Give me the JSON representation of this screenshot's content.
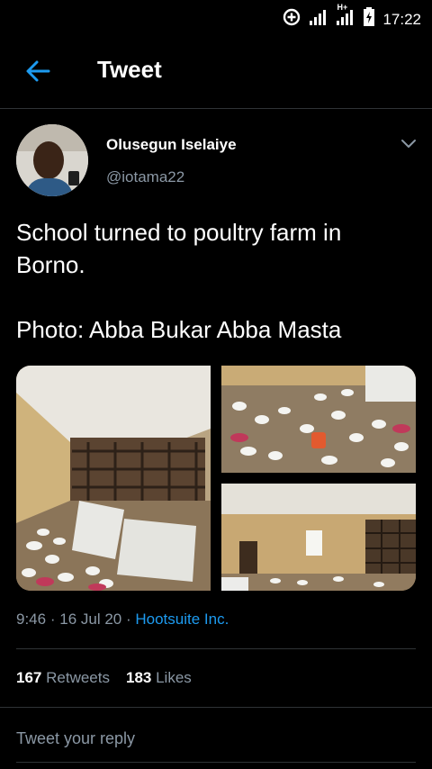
{
  "status_bar": {
    "time": "17:22",
    "network_label": "H+",
    "icons": [
      "data-saver-icon",
      "signal-icon",
      "signal-h-plus-icon",
      "battery-charging-icon"
    ]
  },
  "header": {
    "title": "Tweet",
    "back_icon": "arrow-left-icon",
    "accent_color": "#1d9bf0"
  },
  "tweet": {
    "author_name": "Olusegun Iselaiye",
    "author_handle": "@iotama22",
    "text_line1": "School turned to poultry farm in Borno.",
    "text_line2": "Photo: Abba Bukar Abba Masta",
    "time": "9:46",
    "sep1": "·",
    "date": "16 Jul 20",
    "sep2": "·",
    "source": "Hootsuite Inc.",
    "retweets_count": "167",
    "retweets_label": "Retweets",
    "likes_count": "183",
    "likes_label": "Likes"
  },
  "reply": {
    "placeholder": "Tweet your reply"
  },
  "colors": {
    "background": "#000000",
    "divider": "#2f3336",
    "secondary_text": "#8b98a5",
    "link": "#1d9bf0"
  }
}
